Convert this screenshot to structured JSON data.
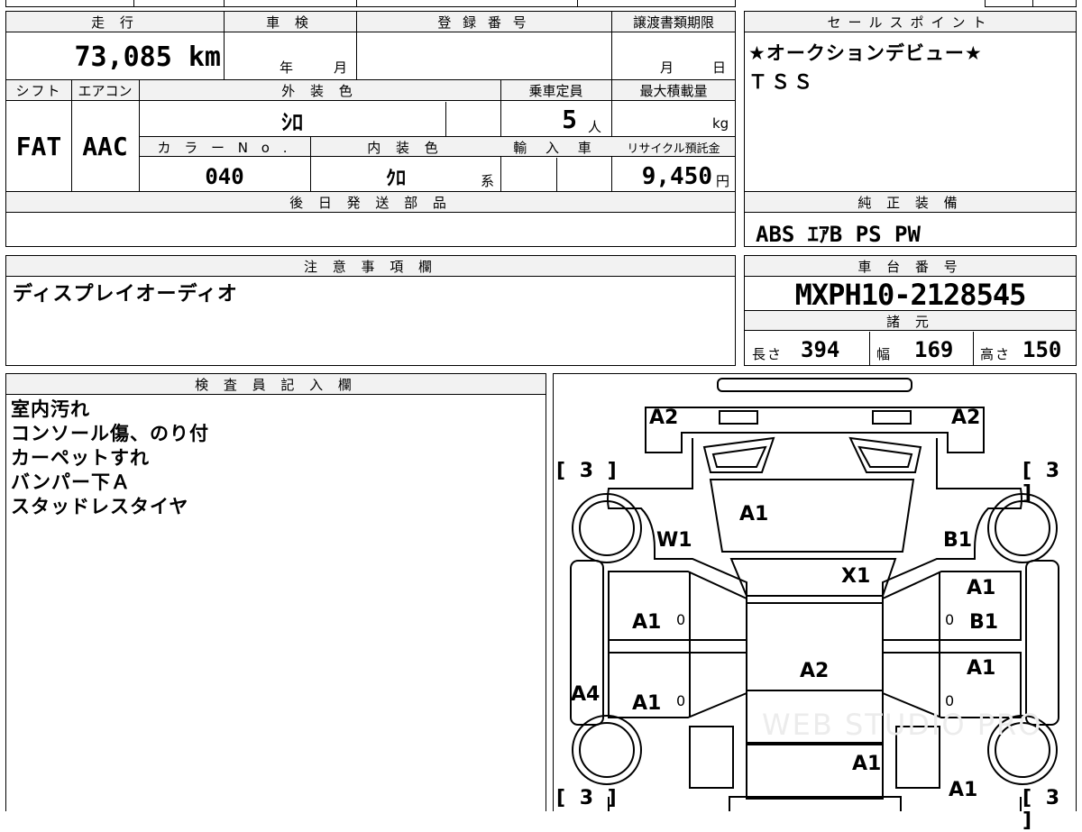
{
  "top_row": {
    "distance_label": "走 行",
    "distance_value": "73,085 km",
    "inspection_label": "車 検",
    "inspection_year": "年",
    "inspection_month": "月",
    "registration_label": "登 録 番 号",
    "transfer_label": "譲渡書類期限",
    "transfer_month": "月",
    "transfer_day": "日"
  },
  "second_row": {
    "shift_label": "シフト",
    "aircon_label": "エアコン",
    "exterior_label": "外 装 色",
    "capacity_label": "乗車定員",
    "maxload_label": "最大積載量",
    "shift_value": "FAT",
    "aircon_value": "AAC",
    "exterior_value": "ｼﾛ",
    "capacity_value": "5",
    "capacity_unit": "人",
    "maxload_unit": "kg",
    "color_no_label": "カ ラ ー N o .",
    "interior_label": "内 装 色",
    "import_label": "輸 入 車",
    "recycle_label": "リサイクル預託金",
    "color_no_value": "040",
    "interior_value": "ｸﾛ",
    "interior_suffix": "系",
    "recycle_value": "9,450",
    "recycle_unit": "円"
  },
  "later_parts": {
    "label": "後 日 発 送 部 品",
    "value": ""
  },
  "sales_point": {
    "label": "セールスポイント",
    "lines": [
      "★オークションデビュー★",
      "ＴＳＳ"
    ]
  },
  "equipment": {
    "label": "純 正 装 備",
    "value": "ABS ｴｱB PS PW"
  },
  "notes": {
    "label": "注 意 事 項 欄",
    "value": "ディスプレイオーディオ"
  },
  "chassis": {
    "label": "車 台 番 号",
    "value": "MXPH10-2128545",
    "spec_label": "諸 元",
    "length_label": "長さ",
    "length_value": "394",
    "width_label": "幅",
    "width_value": "169",
    "height_label": "高さ",
    "height_value": "150"
  },
  "inspector": {
    "label": "検 査 員 記 入 欄",
    "lines": [
      "室内汚れ",
      "コンソール傷、のり付",
      "カーペットすれ",
      "バンパー下Ａ",
      "スタッドレスタイヤ"
    ]
  },
  "diagram": {
    "marks": {
      "front_left": "A2",
      "front_right": "A2",
      "tire_fl": "[ 3 ]",
      "tire_fr": "[ 3 ]",
      "tire_rl": "[ 3 ]",
      "tire_rr": "[ 3 ]",
      "hood": "A1",
      "fender_l": "W1",
      "fender_r": "B1",
      "windshield": "X1",
      "door_fl": "A1",
      "door_fl_sub": "0",
      "door_fr_top": "A1",
      "door_fr": "B1",
      "door_fr_sub": "0",
      "door_rl": "A1",
      "door_rl_sub": "0",
      "door_rr": "A1",
      "door_rr_sub": "0",
      "roof": "A2",
      "step_l": "A4",
      "rear_glass": "A1",
      "rear_right": "A1"
    },
    "watermark": "WEB STUDIO PRO"
  }
}
